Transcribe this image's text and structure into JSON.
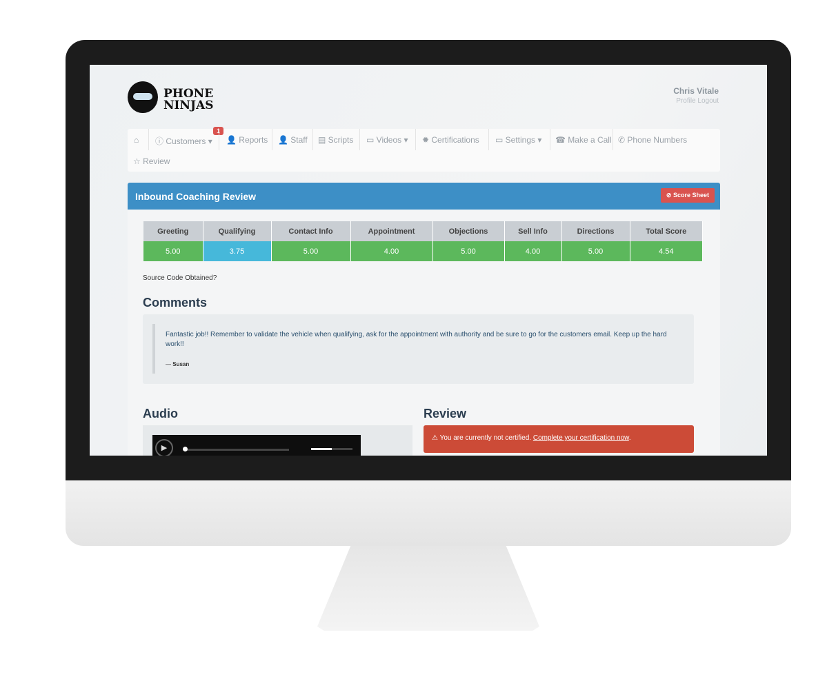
{
  "brand": {
    "line1": "PHONE",
    "line2": "NINJAS"
  },
  "user": {
    "name": "Chris Vitale",
    "profile": "Profile",
    "logout": "Logout"
  },
  "nav": {
    "items": [
      "Customers",
      "Reports",
      "Staff",
      "Scripts",
      "Videos",
      "Certifications",
      "Settings",
      "Make a Call",
      "Phone Numbers",
      "Review"
    ],
    "badge": "1"
  },
  "panel": {
    "title": "Inbound Coaching Review",
    "score_sheet": "Score Sheet",
    "color": "#3d8fc6"
  },
  "scores": {
    "headers": [
      "Greeting",
      "Qualifying",
      "Contact Info",
      "Appointment",
      "Objections",
      "Sell Info",
      "Directions",
      "Total Score"
    ],
    "values": [
      "5.00",
      "3.75",
      "5.00",
      "4.00",
      "5.00",
      "4.00",
      "5.00",
      "4.54"
    ]
  },
  "source_code": "Source Code Obtained?",
  "comments": {
    "title": "Comments",
    "text": "Fantastic job!! Remember to validate the vehicle when qualifying, ask for the appointment with authority and be sure to go for the customers email. Keep up the hard work!!",
    "author": "Susan"
  },
  "audio": {
    "title": "Audio"
  },
  "review": {
    "title": "Review",
    "alert": "You are currently not certified.",
    "link": "Complete your certification now",
    "color": "#cc4b37"
  }
}
